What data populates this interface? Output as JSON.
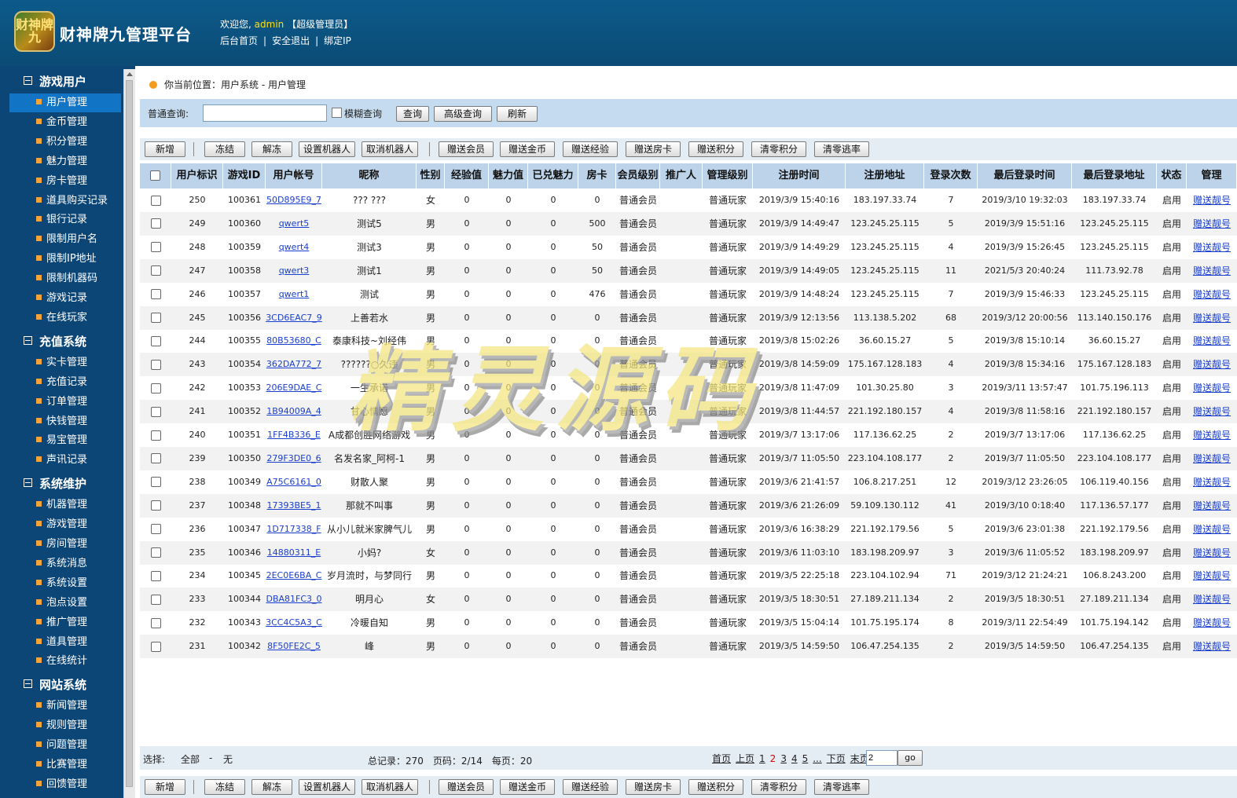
{
  "header": {
    "logo_text": "财神牌九",
    "title": "财神牌九管理平台",
    "welcome_prefix": "欢迎您,",
    "username": "admin",
    "role": "【超级管理员】",
    "links": [
      "后台首页",
      "安全退出",
      "绑定IP"
    ]
  },
  "sidebar": {
    "groups": [
      {
        "label": "游戏用户",
        "items": [
          "用户管理",
          "金币管理",
          "积分管理",
          "魅力管理",
          "房卡管理",
          "道具购买记录",
          "银行记录",
          "限制用户名",
          "限制IP地址",
          "限制机器码",
          "游戏记录",
          "在线玩家"
        ]
      },
      {
        "label": "充值系统",
        "items": [
          "实卡管理",
          "充值记录",
          "订单管理",
          "快钱管理",
          "易宝管理",
          "声讯记录"
        ]
      },
      {
        "label": "系统维护",
        "items": [
          "机器管理",
          "游戏管理",
          "房间管理",
          "系统消息",
          "系统设置",
          "泡点设置",
          "推广管理",
          "道具管理",
          "在线统计"
        ]
      },
      {
        "label": "网站系统",
        "items": [
          "新闻管理",
          "规则管理",
          "问题管理",
          "比赛管理",
          "回馈管理"
        ]
      }
    ],
    "active_item": "用户管理"
  },
  "breadcrumb": "你当前位置：用户系统 - 用户管理",
  "search": {
    "label": "普通查询:",
    "value": "",
    "fuzzy_label": "模糊查询",
    "buttons": [
      "查询",
      "高级查询",
      "刷新"
    ]
  },
  "actions": [
    "新增",
    "冻结",
    "解冻",
    "设置机器人",
    "取消机器人",
    "赠送会员",
    "赠送金币",
    "赠送经验",
    "赠送房卡",
    "赠送积分",
    "清零积分",
    "清零逃率"
  ],
  "table": {
    "columns": [
      "",
      "用户标识",
      "游戏ID",
      "用户帐号",
      "昵称",
      "性别",
      "经验值",
      "魅力值",
      "已兑魅力",
      "房卡",
      "会员级别",
      "推广人",
      "管理级别",
      "注册时间",
      "注册地址",
      "登录次数",
      "最后登录时间",
      "最后登录地址",
      "状态",
      "管理"
    ],
    "rows": [
      [
        "250",
        "100361",
        "50D895E9_7",
        "??? ???",
        "女",
        "0",
        "0",
        "0",
        "0",
        "普通会员",
        "",
        "普通玩家",
        "2019/3/9 15:40:16",
        "183.197.33.74",
        "7",
        "2019/3/10 19:32:03",
        "183.197.33.74",
        "启用",
        "赠送靓号"
      ],
      [
        "249",
        "100360",
        "qwert5",
        "测试5",
        "男",
        "0",
        "0",
        "0",
        "500",
        "普通会员",
        "",
        "普通玩家",
        "2019/3/9 14:49:47",
        "123.245.25.115",
        "5",
        "2019/3/9 15:51:16",
        "123.245.25.115",
        "启用",
        "赠送靓号"
      ],
      [
        "248",
        "100359",
        "qwert4",
        "测试3",
        "男",
        "0",
        "0",
        "0",
        "50",
        "普通会员",
        "",
        "普通玩家",
        "2019/3/9 14:49:29",
        "123.245.25.115",
        "4",
        "2019/3/9 15:26:45",
        "123.245.25.115",
        "启用",
        "赠送靓号"
      ],
      [
        "247",
        "100358",
        "qwert3",
        "测试1",
        "男",
        "0",
        "0",
        "0",
        "50",
        "普通会员",
        "",
        "普通玩家",
        "2019/3/9 14:49:05",
        "123.245.25.115",
        "11",
        "2021/5/3 20:40:24",
        "111.73.92.78",
        "启用",
        "赠送靓号"
      ],
      [
        "246",
        "100357",
        "qwert1",
        "测试",
        "男",
        "0",
        "0",
        "0",
        "476",
        "普通会员",
        "",
        "普通玩家",
        "2019/3/9 14:48:24",
        "123.245.25.115",
        "7",
        "2019/3/9 15:46:33",
        "123.245.25.115",
        "启用",
        "赠送靓号"
      ],
      [
        "245",
        "100356",
        "3CD6EAC7_9",
        "上善若水",
        "男",
        "0",
        "0",
        "0",
        "0",
        "普通会员",
        "",
        "普通玩家",
        "2019/3/9 12:13:56",
        "113.138.5.202",
        "68",
        "2019/3/12 20:00:56",
        "113.140.150.176",
        "启用",
        "赠送靓号"
      ],
      [
        "244",
        "100355",
        "80B53680_C",
        "泰康科技~刘经伟",
        "男",
        "0",
        "0",
        "0",
        "0",
        "普通会员",
        "",
        "普通玩家",
        "2019/3/8 15:02:26",
        "36.60.15.27",
        "5",
        "2019/3/8 15:10:14",
        "36.60.15.27",
        "启用",
        "赠送靓号"
      ],
      [
        "243",
        "100354",
        "362DA772_7",
        "??????○久违",
        "男",
        "0",
        "0",
        "0",
        "0",
        "普通会员",
        "",
        "普通玩家",
        "2019/3/8 14:59:09",
        "175.167.128.183",
        "4",
        "2019/3/8 15:34:16",
        "175.167.128.183",
        "启用",
        "赠送靓号"
      ],
      [
        "242",
        "100353",
        "206E9DAE_C",
        "一生承诺",
        "男",
        "0",
        "0",
        "0",
        "0",
        "普通会员",
        "",
        "普通玩家",
        "2019/3/8 11:47:09",
        "101.30.25.80",
        "3",
        "2019/3/11 13:57:47",
        "101.75.196.113",
        "启用",
        "赠送靓号"
      ],
      [
        "241",
        "100352",
        "1B94009A_4",
        "甘心情愿",
        "男",
        "0",
        "0",
        "0",
        "0",
        "普通会员",
        "",
        "普通玩家",
        "2019/3/8 11:44:57",
        "221.192.180.157",
        "4",
        "2019/3/8 11:58:16",
        "221.192.180.157",
        "启用",
        "赠送靓号"
      ],
      [
        "240",
        "100351",
        "1FF4B336_E",
        "A成都创胜网络游戏",
        "男",
        "0",
        "0",
        "0",
        "0",
        "普通会员",
        "",
        "普通玩家",
        "2019/3/7 13:17:06",
        "117.136.62.25",
        "2",
        "2019/3/7 13:17:06",
        "117.136.62.25",
        "启用",
        "赠送靓号"
      ],
      [
        "239",
        "100350",
        "279F3DE0_6",
        "名发名家_阿柯-1",
        "男",
        "0",
        "0",
        "0",
        "0",
        "普通会员",
        "",
        "普通玩家",
        "2019/3/7 11:05:50",
        "223.104.108.177",
        "2",
        "2019/3/7 11:05:50",
        "223.104.108.177",
        "启用",
        "赠送靓号"
      ],
      [
        "238",
        "100349",
        "A75C6161_0",
        "财散人聚",
        "男",
        "0",
        "0",
        "0",
        "0",
        "普通会员",
        "",
        "普通玩家",
        "2019/3/6 21:41:57",
        "106.8.217.251",
        "12",
        "2019/3/12 23:26:05",
        "106.119.40.156",
        "启用",
        "赠送靓号"
      ],
      [
        "237",
        "100348",
        "17393BE5_1",
        "那就不叫事",
        "男",
        "0",
        "0",
        "0",
        "0",
        "普通会员",
        "",
        "普通玩家",
        "2019/3/6 21:26:09",
        "59.109.130.112",
        "41",
        "2019/3/10 0:18:40",
        "117.136.57.177",
        "启用",
        "赠送靓号"
      ],
      [
        "236",
        "100347",
        "1D717338_F",
        "从小儿就米家脾气儿",
        "男",
        "0",
        "0",
        "0",
        "0",
        "普通会员",
        "",
        "普通玩家",
        "2019/3/6 16:38:29",
        "221.192.179.56",
        "5",
        "2019/3/6 23:01:38",
        "221.192.179.56",
        "启用",
        "赠送靓号"
      ],
      [
        "235",
        "100346",
        "14880311_E",
        "小妈?",
        "女",
        "0",
        "0",
        "0",
        "0",
        "普通会员",
        "",
        "普通玩家",
        "2019/3/6 11:03:10",
        "183.198.209.97",
        "3",
        "2019/3/6 11:05:52",
        "183.198.209.97",
        "启用",
        "赠送靓号"
      ],
      [
        "234",
        "100345",
        "2EC0E6BA_C",
        "岁月流时，与梦同行",
        "男",
        "0",
        "0",
        "0",
        "0",
        "普通会员",
        "",
        "普通玩家",
        "2019/3/5 22:25:18",
        "223.104.102.94",
        "71",
        "2019/3/12 21:24:21",
        "106.8.243.200",
        "启用",
        "赠送靓号"
      ],
      [
        "233",
        "100344",
        "DBA81FC3_0",
        "明月心",
        "女",
        "0",
        "0",
        "0",
        "0",
        "普通会员",
        "",
        "普通玩家",
        "2019/3/5 18:30:51",
        "27.189.211.134",
        "2",
        "2019/3/5 18:30:51",
        "27.189.211.134",
        "启用",
        "赠送靓号"
      ],
      [
        "232",
        "100343",
        "3CC4C5A3_C",
        "冷暖自知",
        "男",
        "0",
        "0",
        "0",
        "0",
        "普通会员",
        "",
        "普通玩家",
        "2019/3/5 15:04:14",
        "101.75.195.174",
        "8",
        "2019/3/11 22:54:49",
        "101.75.194.142",
        "启用",
        "赠送靓号"
      ],
      [
        "231",
        "100342",
        "8F50FE2C_5",
        "峰",
        "男",
        "0",
        "0",
        "0",
        "0",
        "普通会员",
        "",
        "普通玩家",
        "2019/3/5 14:59:50",
        "106.47.254.135",
        "2",
        "2019/3/5 14:59:50",
        "106.47.254.135",
        "启用",
        "赠送靓号"
      ]
    ]
  },
  "footer": {
    "select_label": "选择:",
    "select_all": "全部",
    "dash": "-",
    "select_none": "无",
    "stats": "总记录：270　页码：2/14　每页：20",
    "pager": [
      "首页",
      "上页",
      "1",
      "2",
      "3",
      "4",
      "5",
      "...",
      "下页",
      "末页"
    ],
    "current_page": "2",
    "page_input": "2",
    "go_label": "go"
  },
  "watermark": "精灵源码"
}
